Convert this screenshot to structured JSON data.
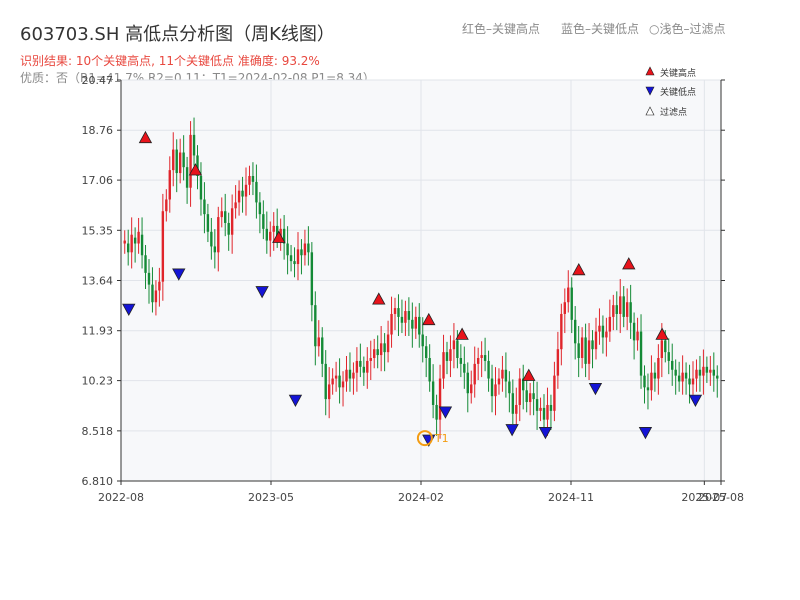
{
  "header": {
    "title": "603703.SH 高低点分析图（周K线图）",
    "color_hint_red": "红色–关键高点",
    "color_hint_blue": "蓝色–关键低点",
    "color_hint_filtered": "○浅色–过滤点",
    "result_line": "识别结果: 10个关键高点, 11个关键低点  准确度: 93.2%",
    "quality_line": "优质：否（R1=41.7%  R2=0.11；T1=2024-02-08 P1=8.34）"
  },
  "colors": {
    "up": "#e0252b",
    "down": "#148a36",
    "high_marker": "#e8131b",
    "low_marker": "#1414d6",
    "t1_ring": "#f39c12",
    "plot_bg": "#f7f8fa"
  },
  "chart_data": {
    "type": "candlestick",
    "ylim": [
      6.81,
      20.47
    ],
    "y_ticks": [
      "20.47",
      "18.76",
      "17.06",
      "15.35",
      "13.64",
      "11.93",
      "10.23",
      "8.518",
      "6.810"
    ],
    "x_ticks": [
      "2022-08",
      "2023-05",
      "2024-02",
      "2024-11",
      "2025-07",
      "2025-08"
    ],
    "legend": {
      "high": "关键高点",
      "low": "关键低点",
      "filtered": "过滤点"
    },
    "candles_close": [
      15.0,
      14.6,
      15.2,
      14.9,
      15.3,
      14.5,
      13.9,
      13.5,
      12.9,
      13.3,
      13.6,
      16.0,
      16.4,
      17.4,
      18.1,
      17.3,
      18.0,
      17.5,
      16.8,
      18.6,
      17.9,
      17.2,
      16.4,
      15.9,
      15.3,
      14.8,
      14.6,
      15.8,
      16.0,
      15.6,
      15.2,
      16.1,
      16.3,
      16.7,
      16.5,
      16.9,
      17.2,
      17.0,
      16.3,
      15.9,
      15.4,
      15.0,
      15.3,
      15.5,
      15.1,
      15.4,
      14.9,
      14.5,
      14.3,
      14.2,
      14.7,
      14.5,
      14.9,
      14.6,
      12.8,
      11.4,
      11.7,
      10.8,
      9.6,
      10.1,
      10.3,
      10.4,
      10.0,
      10.2,
      10.6,
      10.3,
      10.5,
      10.9,
      10.7,
      10.5,
      10.9,
      11.0,
      11.3,
      11.1,
      11.5,
      11.2,
      11.8,
      12.5,
      12.7,
      12.4,
      12.2,
      12.6,
      12.3,
      12.0,
      12.4,
      11.8,
      11.4,
      11.0,
      10.2,
      9.4,
      8.9,
      10.3,
      11.2,
      10.9,
      11.3,
      11.6,
      11.0,
      10.8,
      10.5,
      9.8,
      10.1,
      10.8,
      11.0,
      11.1,
      10.9,
      10.3,
      9.7,
      10.1,
      10.3,
      10.6,
      10.2,
      9.8,
      9.1,
      9.4,
      10.3,
      9.9,
      9.5,
      9.8,
      9.6,
      9.2,
      9.3,
      8.9,
      9.4,
      9.2,
      10.4,
      11.3,
      12.5,
      12.9,
      13.4,
      12.3,
      11.5,
      11.0,
      11.7,
      10.8,
      11.6,
      11.3,
      11.9,
      12.1,
      11.7,
      11.9,
      12.4,
      12.8,
      12.5,
      13.1,
      12.4,
      12.9,
      12.2,
      11.6,
      11.9,
      10.4,
      10.0,
      9.9,
      10.5,
      10.3,
      11.0,
      11.6,
      11.2,
      10.9,
      10.6,
      10.4,
      10.2,
      10.5,
      10.3,
      10.1,
      10.3,
      10.6,
      10.4,
      10.7,
      10.5,
      10.6,
      10.4,
      10.3
    ],
    "candles_open": [
      14.9,
      14.9,
      14.6,
      15.1,
      14.9,
      15.2,
      14.5,
      13.9,
      13.5,
      12.9,
      13.3,
      13.6,
      16.0,
      16.4,
      17.4,
      18.1,
      17.3,
      18.0,
      17.5,
      16.8,
      18.6,
      17.9,
      17.2,
      16.4,
      15.9,
      15.3,
      14.8,
      14.6,
      15.8,
      16.0,
      15.6,
      15.2,
      16.1,
      16.3,
      16.7,
      16.5,
      16.9,
      17.2,
      17.0,
      16.3,
      15.9,
      15.4,
      15.0,
      15.3,
      15.5,
      15.1,
      15.4,
      14.9,
      14.5,
      14.3,
      14.2,
      14.7,
      14.5,
      14.9,
      14.6,
      12.8,
      11.4,
      11.7,
      10.8,
      9.6,
      10.1,
      10.3,
      10.4,
      10.0,
      10.2,
      10.6,
      10.3,
      10.5,
      10.9,
      10.7,
      10.5,
      10.9,
      11.0,
      11.3,
      11.1,
      11.5,
      11.2,
      11.8,
      12.5,
      12.7,
      12.4,
      12.2,
      12.6,
      12.3,
      12.0,
      12.4,
      11.8,
      11.4,
      11.0,
      10.2,
      9.4,
      8.9,
      10.3,
      11.2,
      10.9,
      11.3,
      11.6,
      11.0,
      10.8,
      10.5,
      9.8,
      10.1,
      10.8,
      11.0,
      11.1,
      10.9,
      10.3,
      9.7,
      10.1,
      10.3,
      10.6,
      10.2,
      9.8,
      9.1,
      9.4,
      10.3,
      9.9,
      9.5,
      9.8,
      9.6,
      9.2,
      9.3,
      8.9,
      9.4,
      9.2,
      10.4,
      11.3,
      12.5,
      12.9,
      13.4,
      12.3,
      11.5,
      11.0,
      11.7,
      10.8,
      11.6,
      11.3,
      11.9,
      12.1,
      11.7,
      11.9,
      12.4,
      12.8,
      12.5,
      13.1,
      12.4,
      12.9,
      12.2,
      11.6,
      11.9,
      10.4,
      10.0,
      9.9,
      10.5,
      10.3,
      11.0,
      11.6,
      11.2,
      10.9,
      10.6,
      10.4,
      10.2,
      10.5,
      10.3,
      10.1,
      10.3,
      10.6,
      10.4,
      10.7,
      10.5,
      10.6,
      10.4
    ],
    "key_highs": [
      {
        "date": "2022-09",
        "value": 18.3
      },
      {
        "date": "2022-12",
        "value": 17.2
      },
      {
        "date": "2023-05",
        "value": 14.9
      },
      {
        "date": "2023-11",
        "value": 12.8
      },
      {
        "date": "2024-02",
        "value": 12.1
      },
      {
        "date": "2024-04",
        "value": 11.6
      },
      {
        "date": "2024-08",
        "value": 10.2
      },
      {
        "date": "2024-11",
        "value": 13.8
      },
      {
        "date": "2025-02",
        "value": 14.0
      },
      {
        "date": "2025-04",
        "value": 11.6
      }
    ],
    "key_lows": [
      {
        "date": "2022-08",
        "value": 12.8
      },
      {
        "date": "2022-11",
        "value": 14.0
      },
      {
        "date": "2023-04",
        "value": 13.4
      },
      {
        "date": "2023-06",
        "value": 9.7
      },
      {
        "date": "2024-02",
        "value": 8.34
      },
      {
        "date": "2024-03",
        "value": 9.3
      },
      {
        "date": "2024-07",
        "value": 8.7
      },
      {
        "date": "2024-09",
        "value": 8.6
      },
      {
        "date": "2024-12",
        "value": 10.1
      },
      {
        "date": "2025-03",
        "value": 8.6
      },
      {
        "date": "2025-06",
        "value": 9.7
      }
    ],
    "annotation": {
      "label": "T1",
      "date": "2024-02-08",
      "value": 8.34
    }
  }
}
